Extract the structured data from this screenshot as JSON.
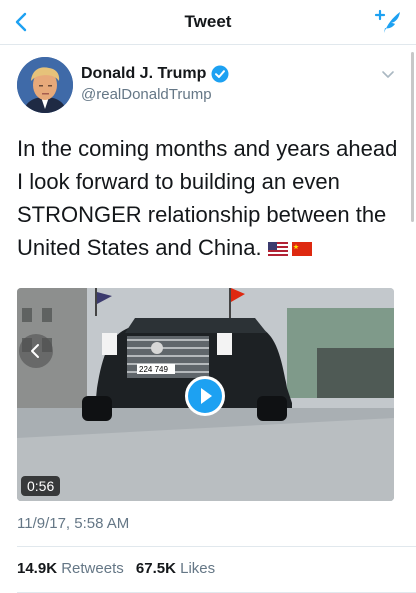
{
  "header": {
    "title": "Tweet",
    "back_icon": "chevron-left-icon",
    "compose_icon": "compose-tweet-icon",
    "accent": "#1da1f2"
  },
  "author": {
    "name": "Donald J. Trump",
    "handle": "@realDonaldTrump",
    "verified": true
  },
  "tweet": {
    "text": "In the coming months and years ahead I look forward to building an even STRONGER relationship between the United States and China.",
    "emoji": [
      "us-flag",
      "china-flag"
    ]
  },
  "media": {
    "duration": "0:56",
    "plate": "224 749"
  },
  "timestamp": "11/9/17, 5:58 AM",
  "stats": {
    "retweets_count": "14.9K",
    "retweets_label": "Retweets",
    "likes_count": "67.5K",
    "likes_label": "Likes"
  }
}
